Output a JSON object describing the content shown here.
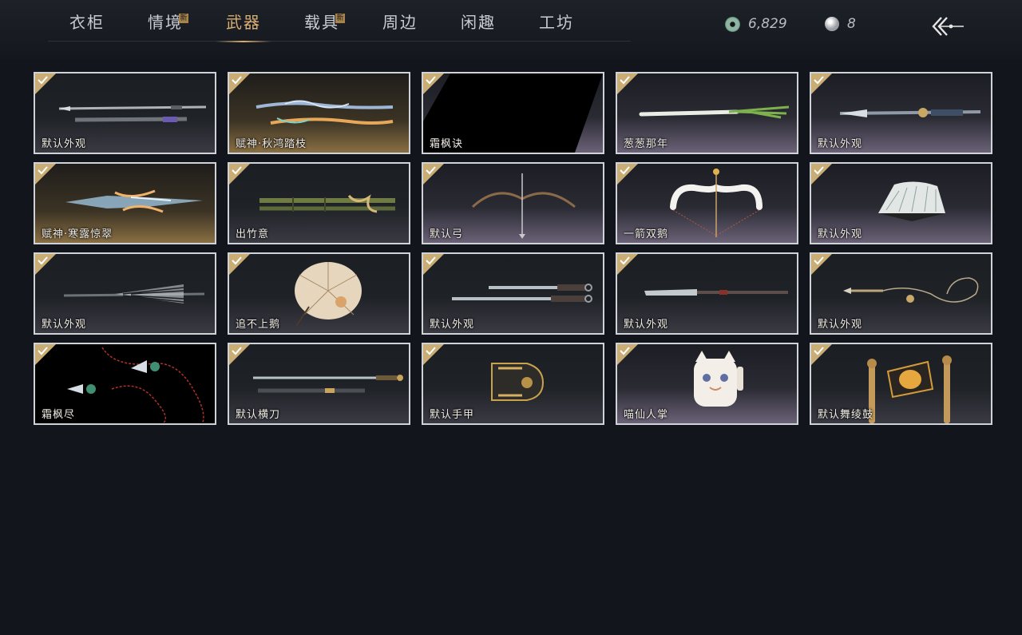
{
  "tabs": [
    {
      "label": "衣柜",
      "new": ""
    },
    {
      "label": "情境",
      "new": "新"
    },
    {
      "label": "武器",
      "new": ""
    },
    {
      "label": "载具",
      "new": "新"
    },
    {
      "label": "周边",
      "new": ""
    },
    {
      "label": "闲趣",
      "new": ""
    },
    {
      "label": "工坊",
      "new": ""
    }
  ],
  "active_tab": "武器",
  "currency": {
    "jade": "6,829",
    "pearl": "8"
  },
  "items": [
    {
      "name": "默认外观",
      "icon": "double-spear"
    },
    {
      "name": "赋神·秋鸿踏枝",
      "icon": "ornate-spears"
    },
    {
      "name": "霜枫诀",
      "icon": "blank-preview"
    },
    {
      "name": "葱葱那年",
      "icon": "scallion-spear"
    },
    {
      "name": "默认外观",
      "icon": "ornate-polearm"
    },
    {
      "name": "赋神·寒露惊翠",
      "icon": "crystal-spear"
    },
    {
      "name": "出竹意",
      "icon": "bamboo-staff"
    },
    {
      "name": "默认弓",
      "icon": "bow"
    },
    {
      "name": "一箭双鹅",
      "icon": "goose-bow"
    },
    {
      "name": "默认外观",
      "icon": "fan"
    },
    {
      "name": "默认外观",
      "icon": "umbrella-spear"
    },
    {
      "name": "追不上鹅",
      "icon": "paper-umbrella"
    },
    {
      "name": "默认外观",
      "icon": "twin-swords"
    },
    {
      "name": "默认外观",
      "icon": "long-blade"
    },
    {
      "name": "默认外观",
      "icon": "rope-dart"
    },
    {
      "name": "霜枫尽",
      "icon": "jade-rope-dart"
    },
    {
      "name": "默认横刀",
      "icon": "saber"
    },
    {
      "name": "默认手甲",
      "icon": "gauntlet"
    },
    {
      "name": "喵仙人掌",
      "icon": "cat-paw"
    },
    {
      "name": "默认舞绫鼓",
      "icon": "dance-drum"
    }
  ]
}
